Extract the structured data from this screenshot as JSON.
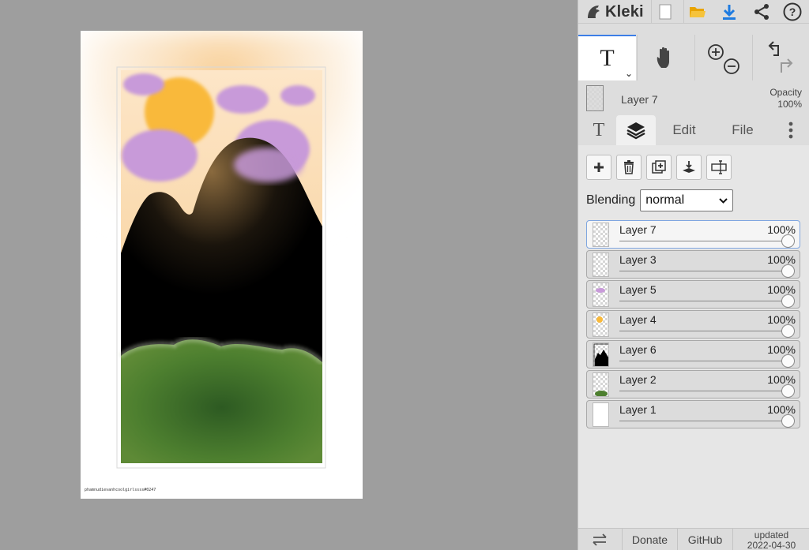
{
  "app": {
    "name": "Kleki"
  },
  "canvas": {
    "signature": "phamnudievanhcoolgirlssss#0247"
  },
  "toolbar": {
    "active_tool": "T",
    "tools": [
      "text",
      "hand",
      "zoom",
      "undo-redo"
    ]
  },
  "current_layer": {
    "name": "Layer 7",
    "opacity_label": "Opacity",
    "opacity_value": "100%"
  },
  "tabs": {
    "text_tab": "T",
    "edit": "Edit",
    "file": "File"
  },
  "blending": {
    "label": "Blending",
    "value": "normal"
  },
  "layers": [
    {
      "name": "Layer 7",
      "opacity": "100%",
      "active": true
    },
    {
      "name": "Layer 3",
      "opacity": "100%",
      "active": false
    },
    {
      "name": "Layer 5",
      "opacity": "100%",
      "active": false
    },
    {
      "name": "Layer 4",
      "opacity": "100%",
      "active": false
    },
    {
      "name": "Layer 6",
      "opacity": "100%",
      "active": false
    },
    {
      "name": "Layer 2",
      "opacity": "100%",
      "active": false
    },
    {
      "name": "Layer 1",
      "opacity": "100%",
      "active": false
    }
  ],
  "footer": {
    "donate": "Donate",
    "github": "GitHub",
    "updated_label": "updated",
    "updated_date": "2022-04-30"
  },
  "colors": {
    "accent": "#3d7ee6",
    "download": "#1e7be0",
    "folder": "#f4b400"
  }
}
